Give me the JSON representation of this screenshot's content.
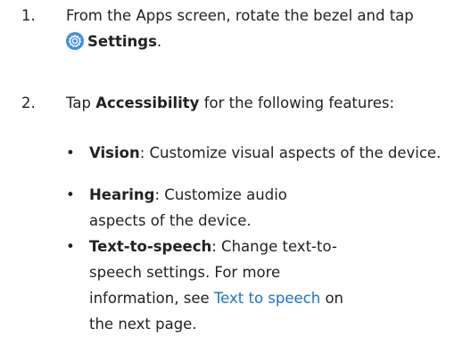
{
  "steps": [
    {
      "number": "1.",
      "prefix": "From the Apps screen, rotate the bezel and tap",
      "icon": "settings-gear-icon",
      "icon_color": "#3b8ee8",
      "term": "Settings",
      "suffix": "."
    },
    {
      "number": "2.",
      "prefix": "Tap",
      "term": "Accessibility",
      "suffix": "for the following features:"
    }
  ],
  "bullets": [
    {
      "marker": "•",
      "term": "Vision",
      "desc": ": Customize visual aspects of the device."
    },
    {
      "marker": "•",
      "term": "Hearing",
      "desc": ": Customize audio aspects of the device."
    },
    {
      "marker": "•",
      "term": "Text-to-speech",
      "desc": ": Change text-to-speech settings. For more information, see",
      "link": "Text to speech",
      "after_link": "on the next page.",
      "link_color": "#1a73c8"
    }
  ]
}
